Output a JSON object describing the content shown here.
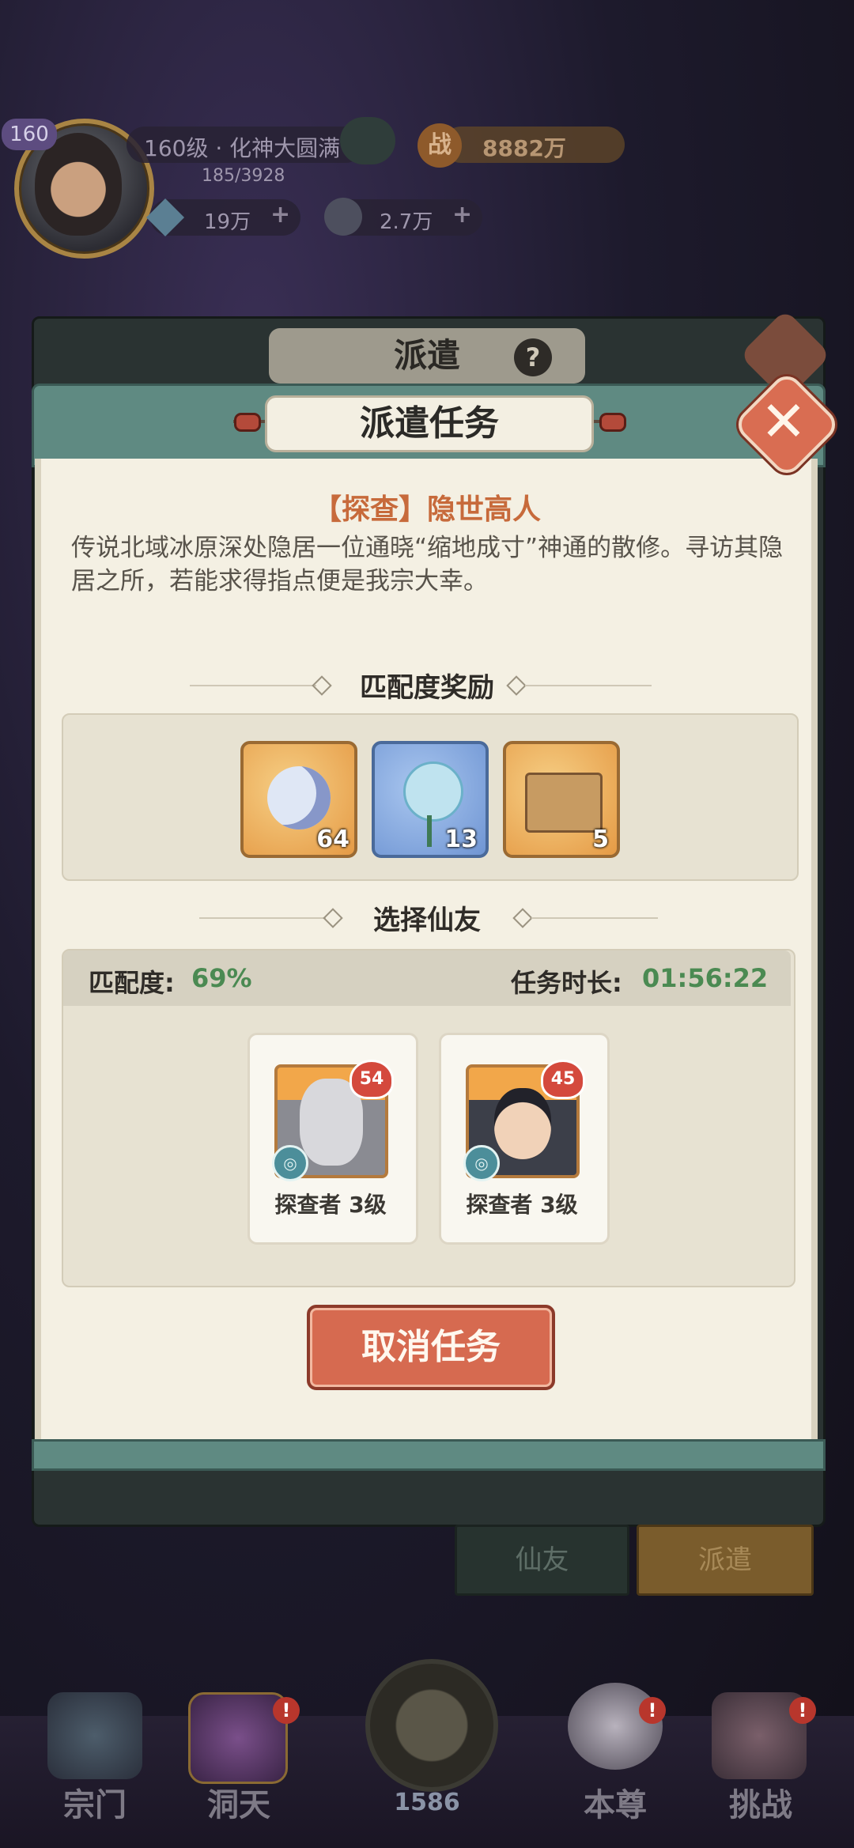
{
  "player": {
    "level_badge": "160",
    "realm": "160级 · 化神大圆满",
    "exp": "185/3928",
    "power_icon": "战",
    "power": "8882万",
    "currency1": "19万",
    "currency2": "2.7万",
    "plus": "+"
  },
  "background_panel": {
    "title": "派遣",
    "help": "?",
    "tabs": [
      "仙友",
      "派遣"
    ]
  },
  "dialog": {
    "title": "派遣任务",
    "close_glyph": "✕",
    "mission_title": "【探查】隐世高人",
    "mission_desc": "传说北域冰原深处隐居一位通晓“缩地成寸”神通的散修。寻访其隐居之所，若能求得指点便是我宗大幸。",
    "rewards_header": "匹配度奖励",
    "rewards": [
      {
        "icon": "spirit-crescent-icon",
        "count": "64",
        "color": "#e9a04e"
      },
      {
        "icon": "ice-rose-icon",
        "count": "13",
        "color": "#7fa4d8"
      },
      {
        "icon": "treasure-chest-icon",
        "count": "5",
        "color": "#e9a04e"
      }
    ],
    "friends_header": "选择仙友",
    "match_label": "匹配度:",
    "match_value": "69%",
    "duration_label": "任务时长:",
    "duration_value": "01:56:22",
    "friends": [
      {
        "level": "54",
        "role_label": "探查者 3级"
      },
      {
        "level": "45",
        "role_label": "探查者 3级"
      }
    ],
    "cancel_button": "取消任务"
  },
  "bottom_nav": {
    "items": [
      "宗门",
      "洞天",
      "",
      "本尊",
      "挑战"
    ],
    "center_value": "1586",
    "alert": "!"
  },
  "colors": {
    "accent_green": "#4b8a52",
    "title_orange": "#c76a3b",
    "button_red": "#d66a50",
    "header_teal": "#5f8a82"
  }
}
